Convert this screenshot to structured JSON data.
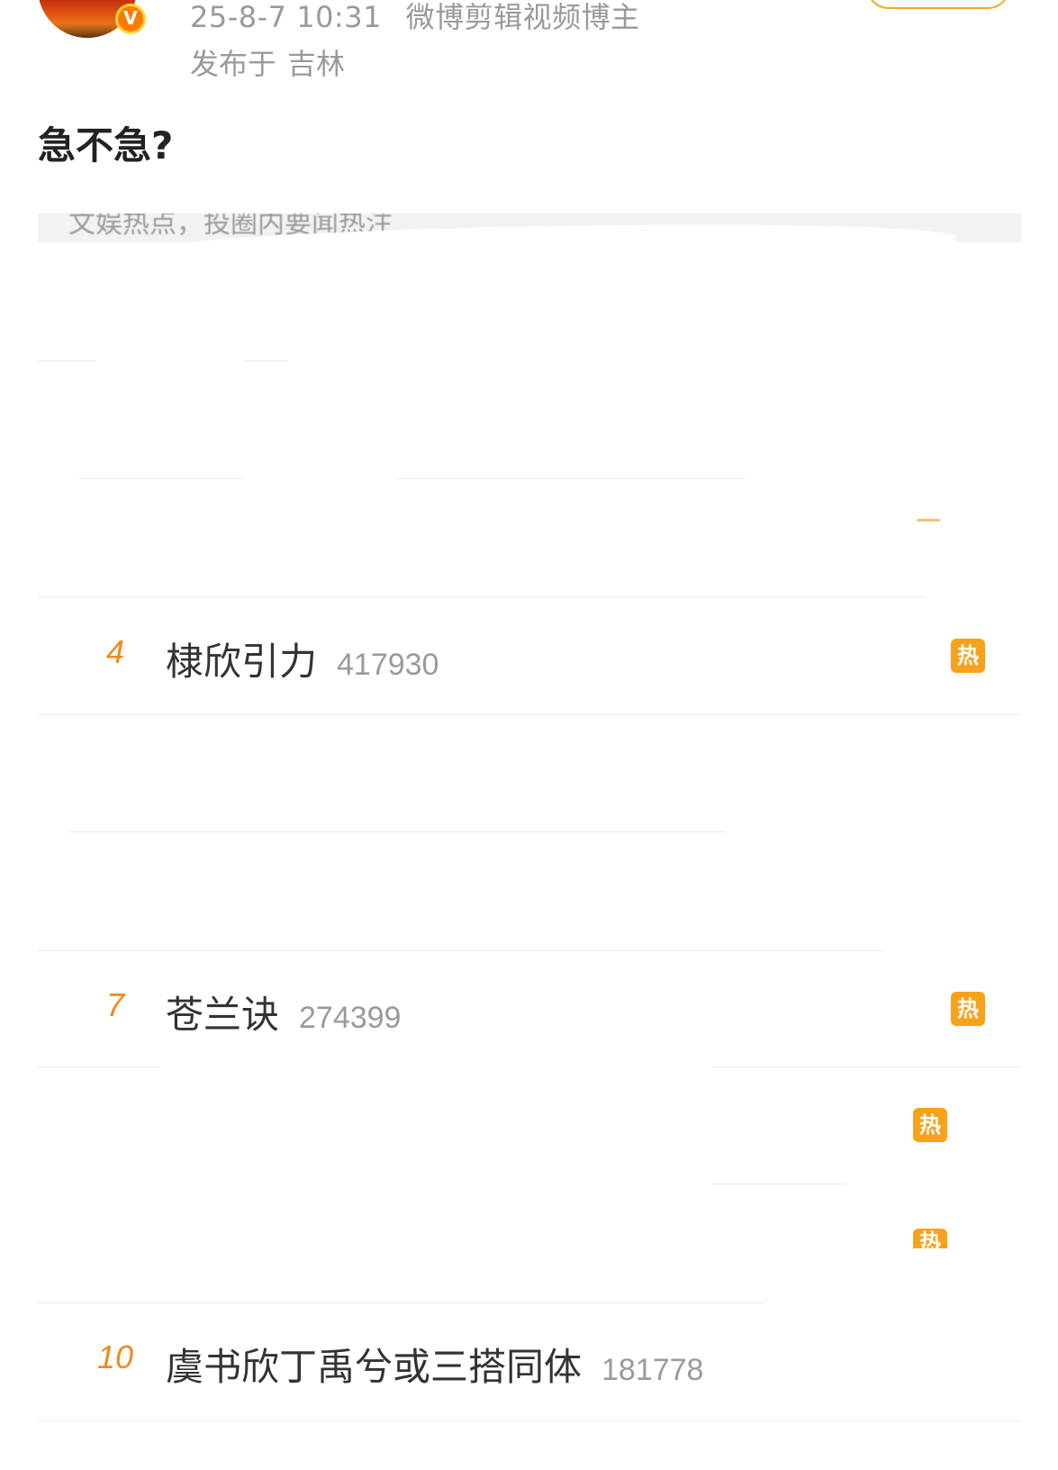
{
  "post": {
    "timestamp": "25-8-7 10:31",
    "author_title": "微博剪辑视频博主",
    "location_prefix": "发布于",
    "location": "吉林",
    "text": "急不急?",
    "verified_badge": "V"
  },
  "hot_search": {
    "header_text": "文娱热点，投圈内要闻热注",
    "items": [
      {
        "rank": "4",
        "title": "棣欣引力",
        "count": "417930",
        "tag": "热"
      },
      {
        "rank": "7",
        "title": "苍兰诀",
        "count": "274399",
        "tag": "热"
      },
      {
        "rank": "10",
        "title": "虞书欣丁禹兮或三搭同体",
        "count": "181778",
        "tag": ""
      }
    ],
    "extra_tags": [
      "热",
      "热"
    ]
  },
  "colors": {
    "accent": "#f7a21b",
    "rank": "#f08a1c",
    "muted_text": "#9a9a9a",
    "primary_text": "#333333"
  }
}
